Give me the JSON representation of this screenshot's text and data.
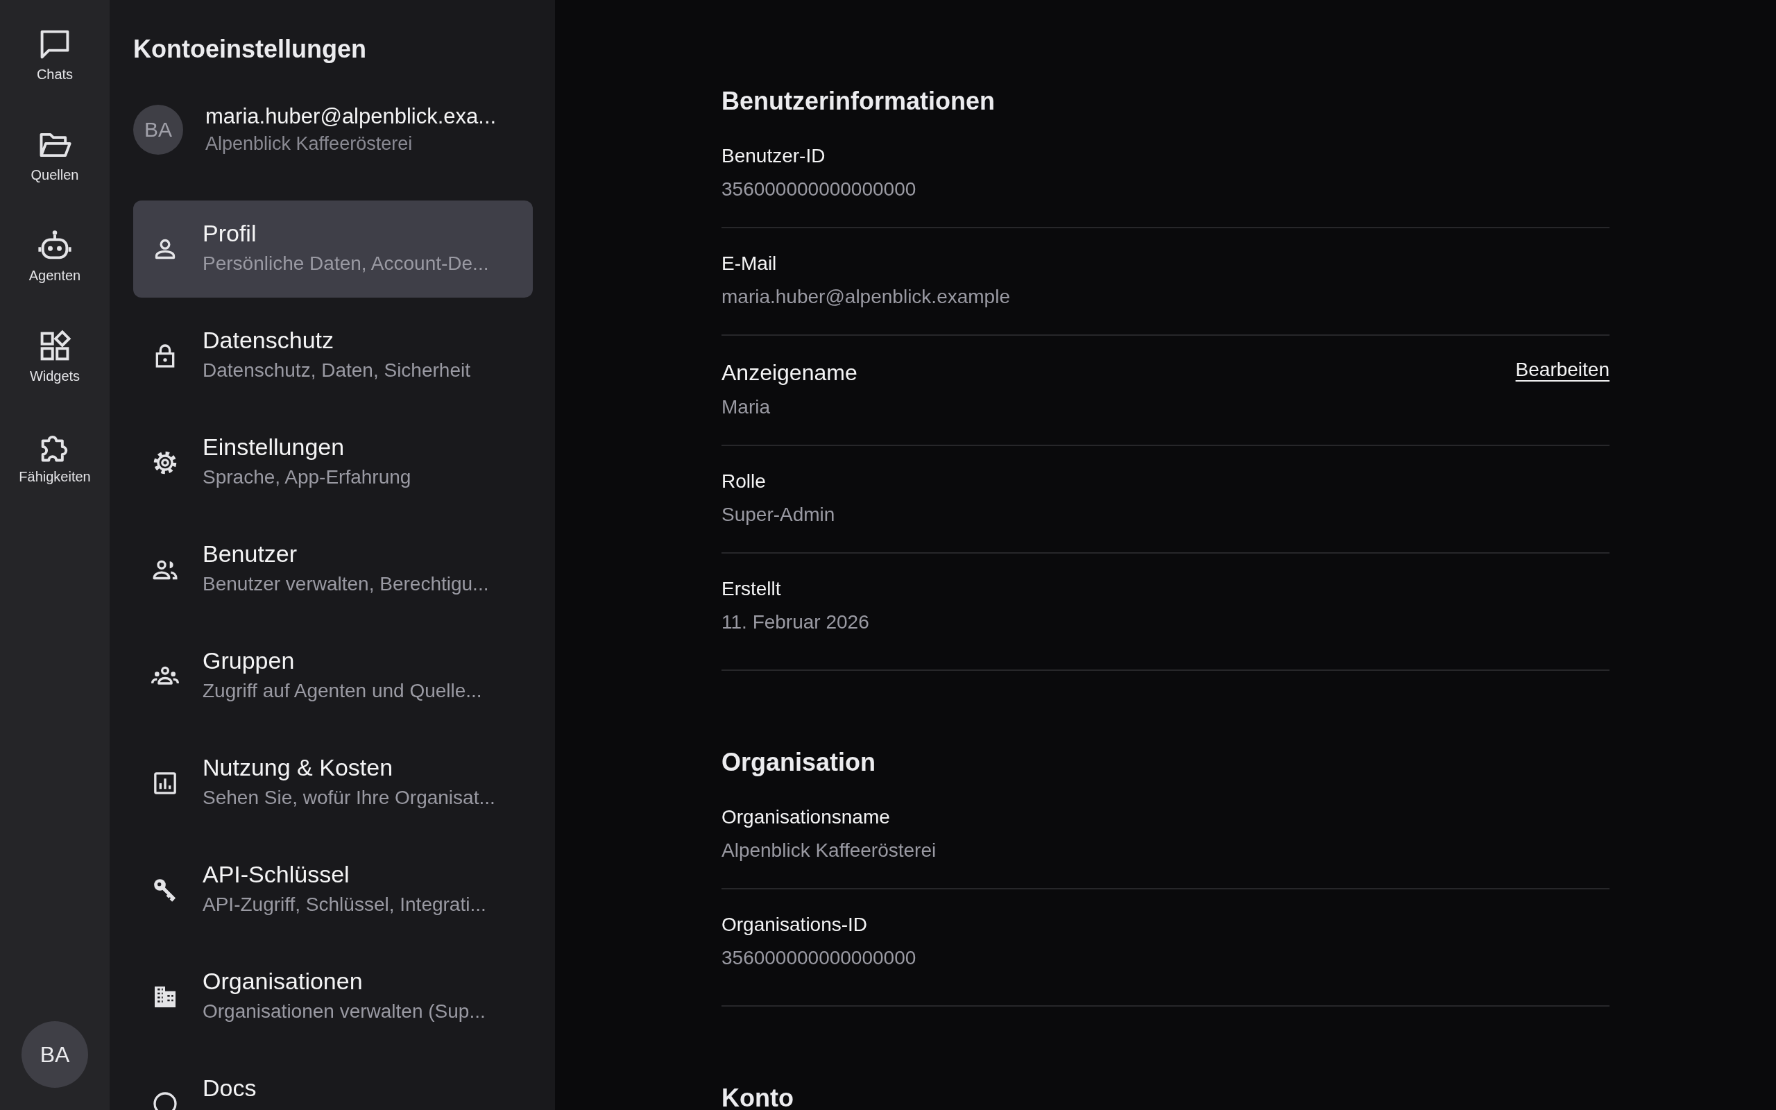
{
  "rail": {
    "items": [
      {
        "label": "Chats",
        "kind": "chat"
      },
      {
        "label": "Quellen",
        "kind": "folder"
      },
      {
        "label": "Agenten",
        "kind": "robot"
      },
      {
        "label": "Widgets",
        "kind": "widgets"
      },
      {
        "label": "Fähigkeiten",
        "kind": "puzzle"
      }
    ],
    "avatar": "BA"
  },
  "sidebar": {
    "title": "Kontoeinstellungen",
    "account": {
      "initials": "BA",
      "email": "maria.huber@alpenblick.exa...",
      "organization": "Alpenblick Kaffeerösterei"
    },
    "items": [
      {
        "title": "Profil",
        "subtitle": "Persönliche Daten, Account-De...",
        "kind": "person",
        "selected": true
      },
      {
        "title": "Datenschutz",
        "subtitle": "Datenschutz, Daten, Sicherheit",
        "kind": "lock",
        "selected": false
      },
      {
        "title": "Einstellungen",
        "subtitle": "Sprache, App-Erfahrung",
        "kind": "gear",
        "selected": false
      },
      {
        "title": "Benutzer",
        "subtitle": "Benutzer verwalten, Berechtigu...",
        "kind": "people",
        "selected": false
      },
      {
        "title": "Gruppen",
        "subtitle": "Zugriff auf Agenten und Quelle...",
        "kind": "groups",
        "selected": false
      },
      {
        "title": "Nutzung & Kosten",
        "subtitle": "Sehen Sie, wofür Ihre Organisat...",
        "kind": "chart",
        "selected": false
      },
      {
        "title": "API-Schlüssel",
        "subtitle": "API-Zugriff, Schlüssel, Integrati...",
        "kind": "key",
        "selected": false
      },
      {
        "title": "Organisationen",
        "subtitle": "Organisationen verwalten (Sup...",
        "kind": "building",
        "selected": false
      },
      {
        "title": "Docs",
        "kind": "circle",
        "selected": false
      }
    ]
  },
  "content": {
    "sections": [
      {
        "title": "Benutzerinformationen",
        "fields": [
          {
            "kind": "plain",
            "label": "Benutzer-ID",
            "value": "356000000000000000"
          },
          {
            "kind": "plain",
            "label": "E-Mail",
            "value": "maria.huber@alpenblick.example"
          },
          {
            "kind": "editable",
            "label": "Anzeigename",
            "value": "Maria",
            "action": "Bearbeiten"
          },
          {
            "kind": "plain",
            "label": "Rolle",
            "value": "Super-Admin"
          },
          {
            "kind": "plain",
            "label": "Erstellt",
            "value": "11. Februar 2026"
          }
        ]
      },
      {
        "title": "Organisation",
        "fields": [
          {
            "kind": "plain",
            "label": "Organisationsname",
            "value": "Alpenblick Kaffeerösterei"
          },
          {
            "kind": "plain",
            "label": "Organisations-ID",
            "value": "356000000000000000"
          }
        ]
      },
      {
        "title": "Konto"
      }
    ]
  }
}
